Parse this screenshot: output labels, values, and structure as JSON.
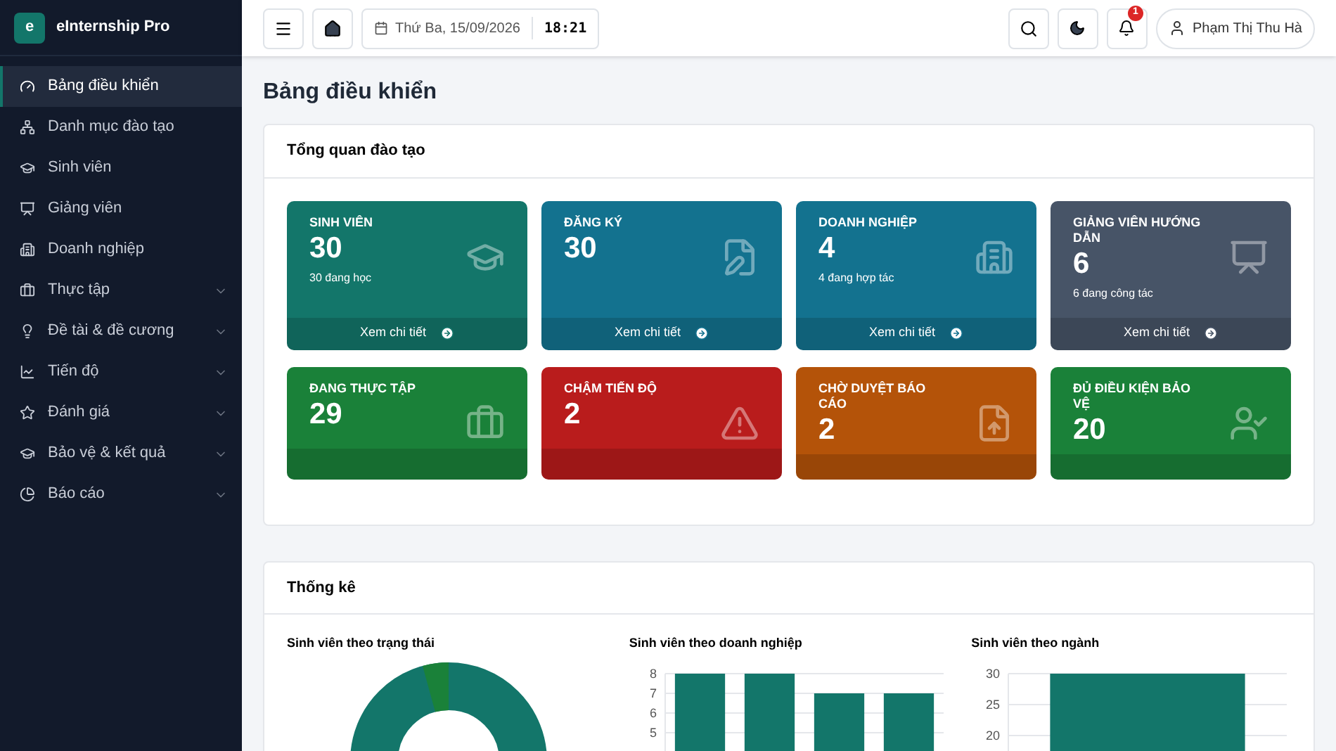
{
  "brand": {
    "logo": "e",
    "name": "eInternship Pro"
  },
  "sidebar": {
    "items": [
      {
        "label": "Bảng điều khiển",
        "selected": true,
        "submenu": false
      },
      {
        "label": "Danh mục đào tạo",
        "selected": false,
        "submenu": false
      },
      {
        "label": "Sinh viên",
        "selected": false,
        "submenu": false
      },
      {
        "label": "Giảng viên",
        "selected": false,
        "submenu": false
      },
      {
        "label": "Doanh nghiệp",
        "selected": false,
        "submenu": false
      },
      {
        "label": "Thực tập",
        "selected": false,
        "submenu": true
      },
      {
        "label": "Đề tài & đề cương",
        "selected": false,
        "submenu": true
      },
      {
        "label": "Tiến độ",
        "selected": false,
        "submenu": true
      },
      {
        "label": "Đánh giá",
        "selected": false,
        "submenu": true
      },
      {
        "label": "Bảo vệ & kết quả",
        "selected": false,
        "submenu": true
      },
      {
        "label": "Báo cáo",
        "selected": false,
        "submenu": true
      }
    ]
  },
  "topbar": {
    "date": "Thứ Ba, 15/09/2026",
    "time": "18:21",
    "notifications": "1",
    "user": "Phạm Thị Thu Hà"
  },
  "page_title": "Bảng điều khiển",
  "overview": {
    "title": "Tổng quan đào tạo",
    "cards": [
      {
        "label": "SINH VIÊN",
        "value": "30",
        "sub": "30 đang học",
        "link": "Xem chi tiết",
        "color": "#13766a"
      },
      {
        "label": "ĐĂNG KÝ",
        "value": "30",
        "link": "Xem chi tiết",
        "color": "#13728f"
      },
      {
        "label": "DOANH NGHIỆP",
        "value": "4",
        "sub": "4 đang hợp tác",
        "link": "Xem chi tiết",
        "color": "#13728f"
      },
      {
        "label": "GIẢNG VIÊN HƯỚNG DẪN",
        "value": "6",
        "sub": "6 đang công tác",
        "link": "Xem chi tiết",
        "color": "#475467"
      },
      {
        "label": "ĐANG THỰC TẬP",
        "value": "29",
        "color": "#1a8139"
      },
      {
        "label": "CHẬM TIẾN ĐỘ",
        "value": "2",
        "color": "#b91c1c"
      },
      {
        "label": "CHỜ DUYỆT BÁO CÁO",
        "value": "2",
        "color": "#b45309"
      },
      {
        "label": "ĐỦ ĐIỀU KIỆN BẢO VỆ",
        "value": "20",
        "color": "#1a8139"
      }
    ]
  },
  "stats": {
    "title": "Thống kê",
    "charts": [
      {
        "title": "Sinh viên theo trạng thái"
      },
      {
        "title": "Sinh viên theo doanh nghiệp",
        "chart_data": {
          "type": "bar",
          "values": [
            8,
            8,
            7,
            7
          ],
          "ylim": [
            0,
            8
          ],
          "yticks": [
            5,
            6,
            7,
            8
          ],
          "grid": true
        }
      },
      {
        "title": "Sinh viên theo ngành",
        "chart_data": {
          "type": "bar",
          "values": [
            30
          ],
          "ylim": [
            0,
            30
          ],
          "yticks": [
            20,
            25,
            30
          ],
          "grid": true
        }
      }
    ]
  }
}
